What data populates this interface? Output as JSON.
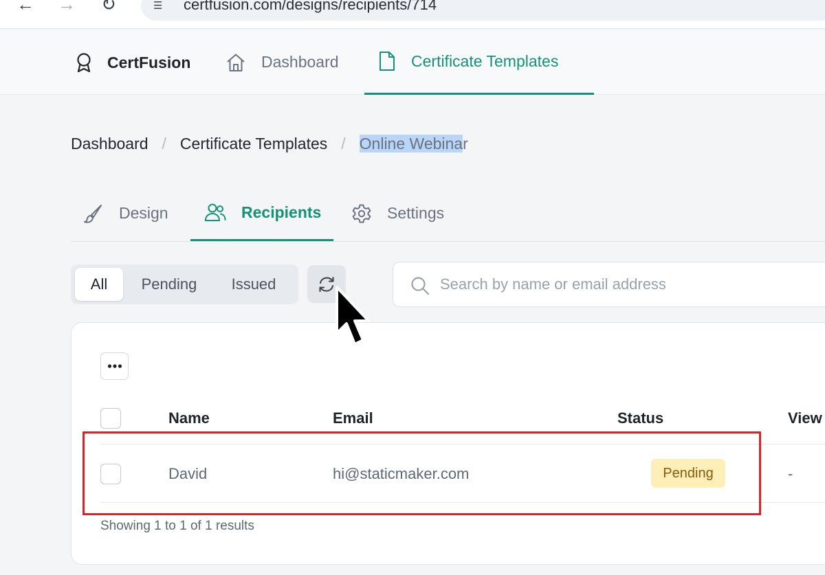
{
  "browser": {
    "url": "certfusion.com/designs/recipients/714"
  },
  "app": {
    "brand": "CertFusion",
    "nav": [
      {
        "label": "Dashboard",
        "icon": "home-icon",
        "active": false
      },
      {
        "label": "Certificate Templates",
        "icon": "file-icon",
        "active": true
      }
    ]
  },
  "breadcrumb": {
    "items": [
      "Dashboard",
      "Certificate Templates"
    ],
    "current_highlighted": "Online Webina",
    "current_rest": "r"
  },
  "tabs": [
    {
      "label": "Design",
      "icon": "brush-icon",
      "active": false
    },
    {
      "label": "Recipients",
      "icon": "users-icon",
      "active": true
    },
    {
      "label": "Settings",
      "icon": "gear-icon",
      "active": false
    }
  ],
  "filters": {
    "options": [
      "All",
      "Pending",
      "Issued"
    ],
    "selected": "All"
  },
  "search": {
    "placeholder": "Search by name or email address",
    "value": ""
  },
  "table": {
    "columns": [
      "Name",
      "Email",
      "Status",
      "View"
    ],
    "rows": [
      {
        "name": "David",
        "email": "hi@staticmaker.com",
        "status": "Pending",
        "view": "-"
      }
    ],
    "summary": "Showing 1 to 1 of 1 results"
  },
  "colors": {
    "accent": "#149278",
    "badge_pending_bg": "#fcefb8",
    "badge_pending_text": "#8a5a0a",
    "highlight_box": "#d2262b",
    "text_selection": "#b9d5f8"
  }
}
